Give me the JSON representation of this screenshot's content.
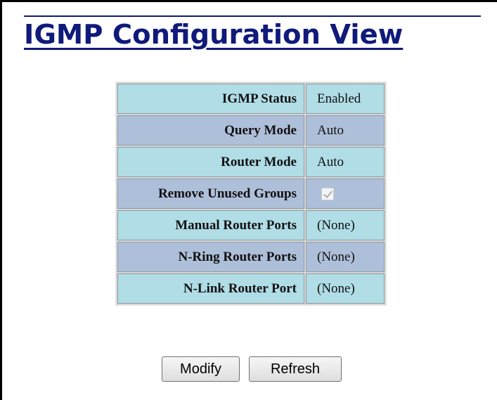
{
  "page": {
    "title": "IGMP Configuration View"
  },
  "settings": [
    {
      "label": "IGMP Status",
      "value": "Enabled"
    },
    {
      "label": "Query Mode",
      "value": "Auto"
    },
    {
      "label": "Router Mode",
      "value": "Auto"
    },
    {
      "label": "Remove Unused Groups",
      "value": null,
      "checked": true,
      "disabled": true
    },
    {
      "label": "Manual Router Ports",
      "value": "(None)"
    },
    {
      "label": "N-Ring Router Ports",
      "value": "(None)"
    },
    {
      "label": "N-Link Router Port",
      "value": "(None)"
    }
  ],
  "buttons": {
    "modify_label": "Modify",
    "refresh_label": "Refresh"
  },
  "colors": {
    "title": "#101a7a",
    "row_light": "#b0dde6",
    "row_dark": "#aebfd9"
  }
}
